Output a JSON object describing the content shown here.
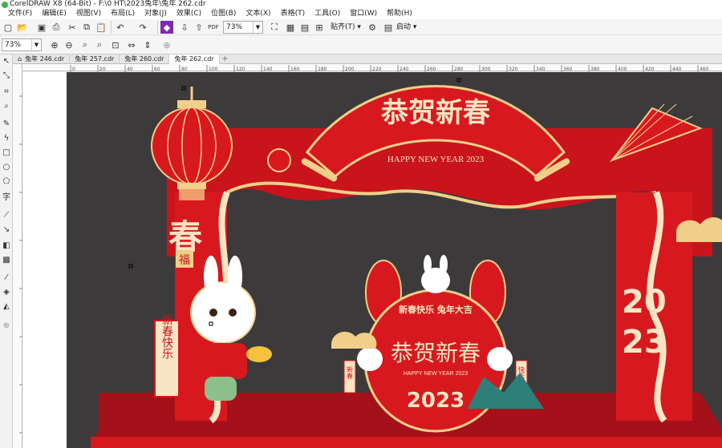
{
  "window": {
    "title": "CorelDRAW X8 (64-Bit) - F:\\0 HT\\2023兔年\\兔年 262.cdr"
  },
  "menu": [
    "文件(F)",
    "编辑(E)",
    "视图(V)",
    "布局(L)",
    "对象(J)",
    "效果(C)",
    "位图(B)",
    "文本(X)",
    "表格(T)",
    "工具(O)",
    "窗口(W)",
    "帮助(H)"
  ],
  "toolbar": {
    "zoom_value": "73%",
    "snap_label": "贴齐(T)",
    "launch_label": "启动"
  },
  "propertybar": {
    "zoom_value": "73%"
  },
  "tabs": [
    "兔年 246.cdr",
    "兔年 257.cdr",
    "兔年 260.cdr",
    "兔年 262.cdr"
  ],
  "active_tab": 3,
  "ruler": {
    "h_ticks": [
      "0",
      "20",
      "40",
      "60",
      "80",
      "100",
      "120",
      "140",
      "160",
      "180",
      "200",
      "220",
      "240",
      "260",
      "280",
      "300",
      "320",
      "340",
      "360",
      "380",
      "400",
      "420",
      "440",
      "460",
      "480"
    ]
  },
  "artwork": {
    "banner_title": "恭贺新春",
    "banner_subtitle": "HAPPY NEW YEAR 2023",
    "spring_char": "春",
    "fu_char": "福",
    "scroll_text": "新春快乐",
    "center_arc_text": "新春快乐 兔年大吉",
    "center_title": "恭贺新春",
    "center_subtitle": "HAPPY NEW YEAR 2023",
    "center_year": "2023",
    "left_couplet": "新春",
    "right_couplet": "快乐",
    "side_year_top": "20",
    "side_year_bottom": "23",
    "colors": {
      "bg_dark": "#3d3a3b",
      "red": "#d7191f",
      "deep_red": "#a8101a",
      "gold": "#f0cf8a",
      "cream": "#f7e5c3",
      "floor": "#b5141c"
    }
  }
}
